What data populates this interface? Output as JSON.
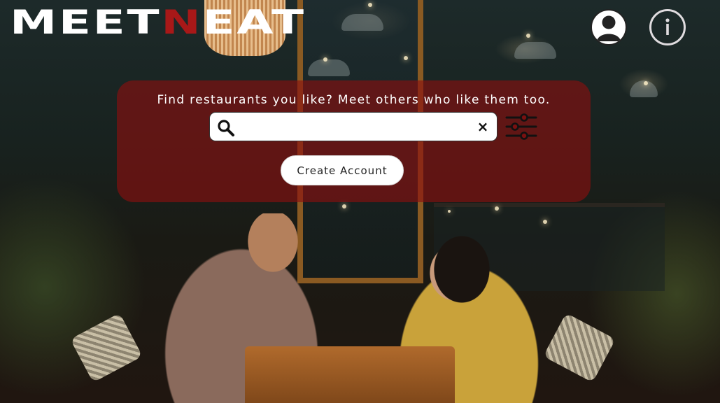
{
  "brand": {
    "logo_part1": "MEET",
    "logo_part2": "N",
    "logo_part3": "EAT",
    "primary_color": "#ffffff",
    "accent_color": "#a81818"
  },
  "header": {
    "profile_icon": "user-circle-icon",
    "info_icon": "info-circle-icon"
  },
  "hero": {
    "tagline": "Find restaurants you like? Meet others who like them too.",
    "panel_color": "#8c0f0f",
    "search": {
      "value": "",
      "placeholder": "",
      "search_icon": "search-icon",
      "clear_label": "×"
    },
    "filter_icon": "sliders-icon",
    "create_account_label": "Create Account"
  }
}
